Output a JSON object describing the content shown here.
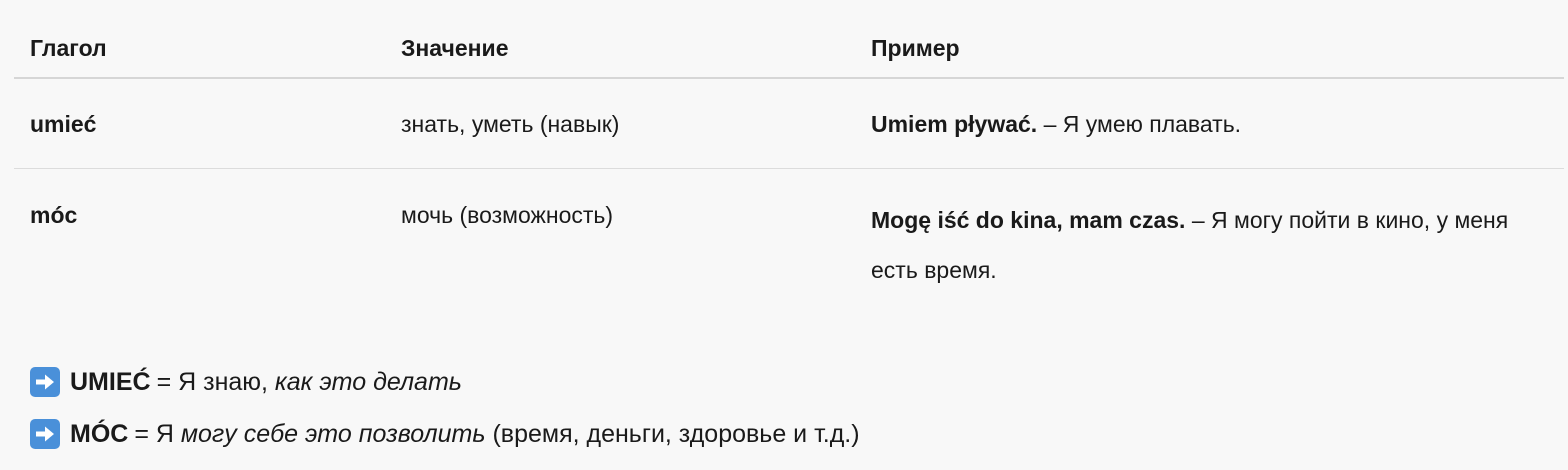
{
  "table": {
    "headers": {
      "verb": "Глагол",
      "meaning": "Значение",
      "example": "Пример"
    },
    "rows": [
      {
        "verb": "umieć",
        "meaning": "знать, уметь (навык)",
        "example_pl": "Umiem pływać.",
        "example_ru": " – Я умею плавать."
      },
      {
        "verb": "móc",
        "meaning": "мочь (возможность)",
        "example_pl": "Mogę iść do kina, mam czas.",
        "example_ru": " – Я могу пойти в кино, у меня есть время."
      }
    ]
  },
  "notes": [
    {
      "icon": "right-arrow-icon",
      "keyword": "UMIEĆ",
      "plain": "= Я знаю, ",
      "italic": "как это делать",
      "tail": ""
    },
    {
      "icon": "right-arrow-icon",
      "keyword": "MÓC",
      "plain": "= Я ",
      "italic": "могу себе это позволить",
      "tail": " (время, деньги, здоровье и т.д.)"
    }
  ],
  "colors": {
    "background": "#f8f8f8",
    "arrow_badge": "#4a90d9",
    "divider": "#dcdcdc"
  }
}
